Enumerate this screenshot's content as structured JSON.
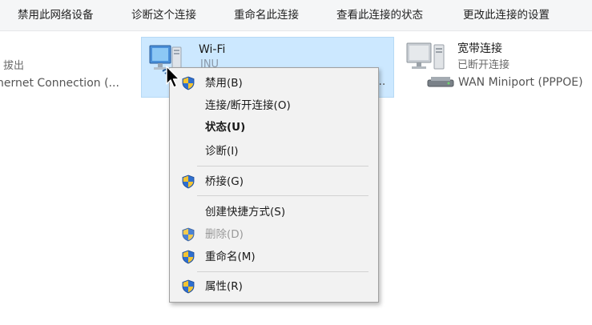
{
  "toolbar": {
    "disable_label": "禁用此网络设备",
    "diagnose_label": "诊断这个连接",
    "rename_label": "重命名此连接",
    "view_status_label": "查看此连接的状态",
    "change_settings_label": "更改此连接的设置"
  },
  "adapters": {
    "ethernet": {
      "status": "拔出",
      "device": "hernet Connection (..."
    },
    "wifi": {
      "name": "Wi-Fi",
      "status": "JNU",
      "device_truncation": "..."
    },
    "broadband": {
      "name": "宽带连接",
      "status": "已断开连接",
      "device": "WAN Miniport (PPPOE)"
    }
  },
  "context_menu": {
    "items": [
      {
        "label": "禁用(B)",
        "shield": true
      },
      {
        "label": "连接/断开连接(O)",
        "shield": false
      },
      {
        "label": "状态(U)",
        "shield": false,
        "bold": true
      },
      {
        "label": "诊断(I)",
        "shield": false
      },
      {
        "label": "桥接(G)",
        "shield": true
      },
      {
        "label": "创建快捷方式(S)",
        "shield": false
      },
      {
        "label": "删除(D)",
        "shield": true,
        "disabled": true
      },
      {
        "label": "重命名(M)",
        "shield": true
      },
      {
        "label": "属性(R)",
        "shield": true
      }
    ]
  },
  "colors": {
    "selection": "#cce8ff",
    "menu_background": "#f2f2f2",
    "shield_blue": "#2f6fcf",
    "shield_yellow": "#f4c430"
  }
}
